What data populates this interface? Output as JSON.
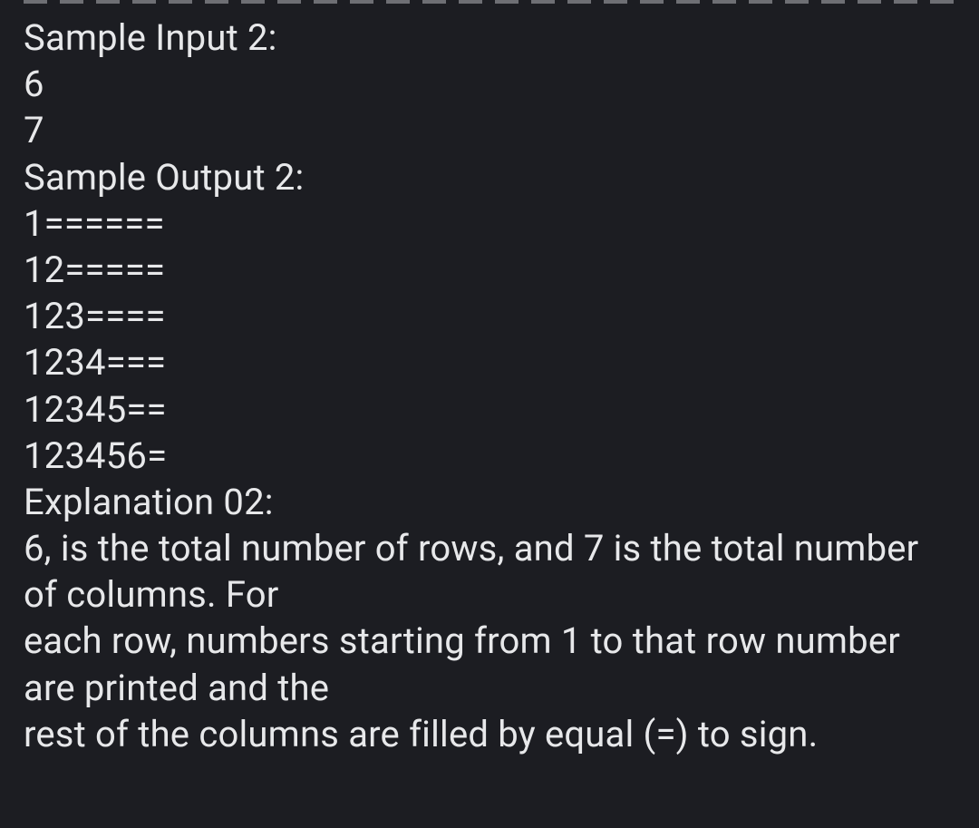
{
  "lines": {
    "sample_input_label": "Sample Input 2:",
    "input_line_1": "6",
    "input_line_2": "7",
    "sample_output_label": "Sample Output 2:",
    "output_line_1": "1======",
    "output_line_2": "12=====",
    "output_line_3": "123====",
    "output_line_4": "1234===",
    "output_line_5": "12345==",
    "output_line_6": "123456=",
    "explanation_label": "Explanation 02:",
    "explanation_line_1": "6, is the total number of rows, and 7 is the total number of columns. For",
    "explanation_line_2": "each row, numbers starting from 1 to that row number are printed and the",
    "explanation_line_3": "rest of the columns are filled by equal (=) to sign."
  }
}
